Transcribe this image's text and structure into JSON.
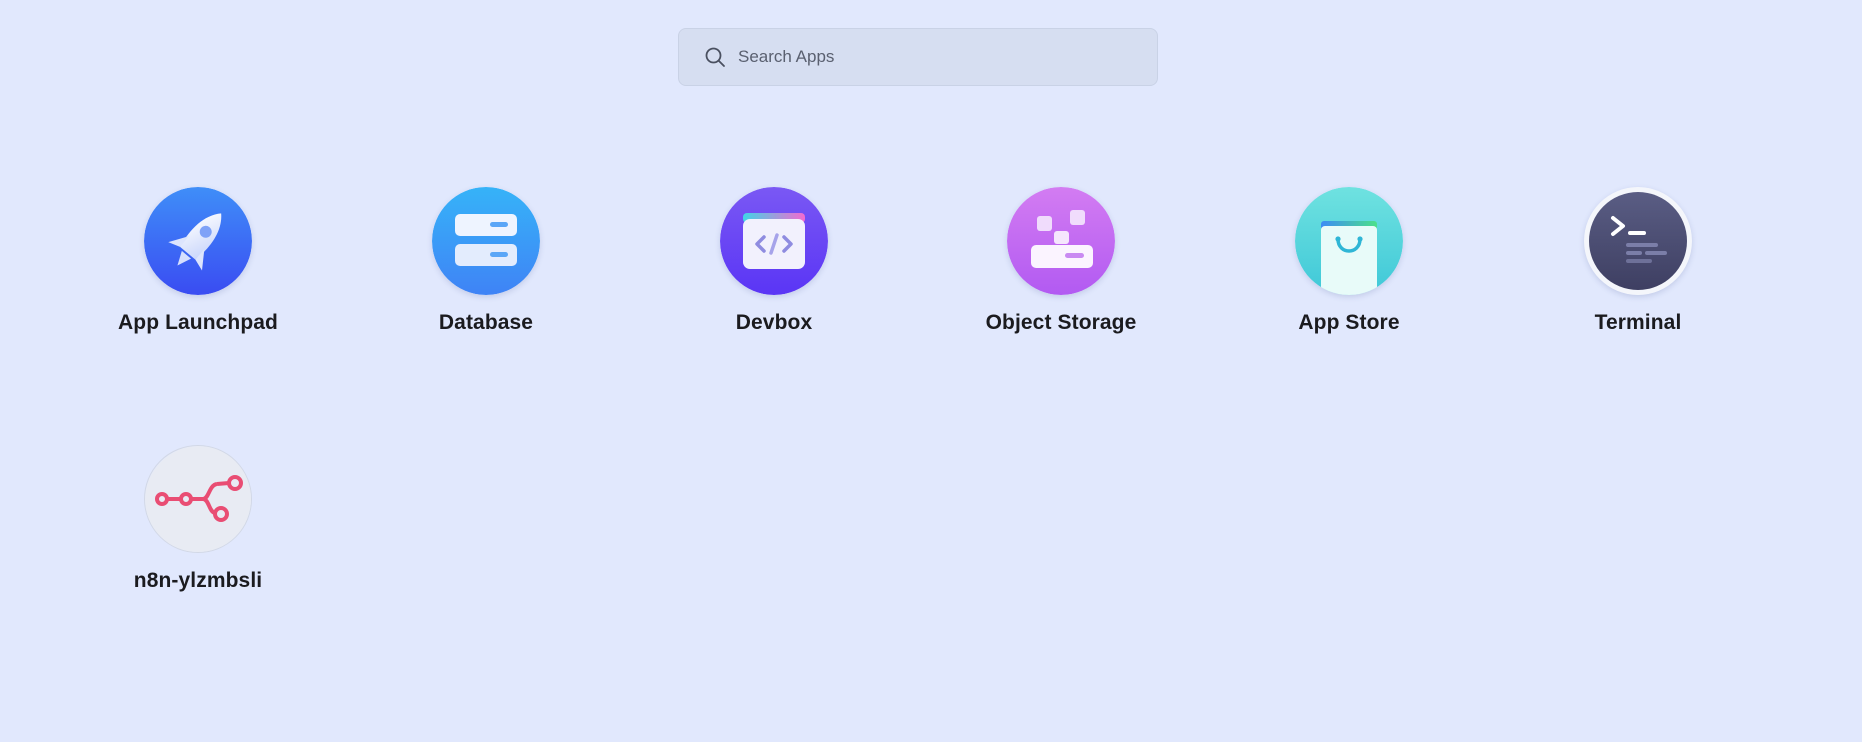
{
  "search": {
    "placeholder": "Search Apps",
    "value": ""
  },
  "apps": [
    {
      "label": "App Launchpad",
      "icon": "rocket-icon",
      "color": "#3d6cf5"
    },
    {
      "label": "Database",
      "icon": "database-icon",
      "color": "#3f97f6"
    },
    {
      "label": "Devbox",
      "icon": "devbox-code-icon",
      "color": "#6247f5"
    },
    {
      "label": "Object Storage",
      "icon": "object-storage-icon",
      "color": "#c86cf2"
    },
    {
      "label": "App Store",
      "icon": "shopping-bag-icon",
      "color": "#4fd6d8"
    },
    {
      "label": "Terminal",
      "icon": "terminal-icon",
      "color": "#4f5275"
    },
    {
      "label": "n8n-ylzmbsli",
      "icon": "n8n-workflow-icon",
      "color": "#ea4b71"
    }
  ]
}
